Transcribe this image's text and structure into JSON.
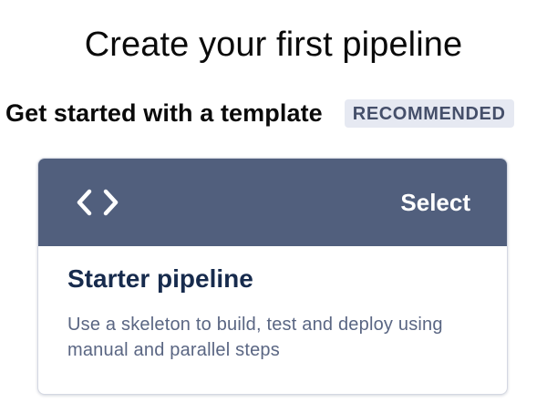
{
  "page": {
    "title": "Create your first pipeline"
  },
  "template_section": {
    "heading": "Get started with a template",
    "badge": "RECOMMENDED"
  },
  "template_card": {
    "icon": "code-icon",
    "action_label": "Select",
    "title": "Starter pipeline",
    "description": "Use a skeleton to build, test and deploy using manual and parallel steps"
  },
  "colors": {
    "card_header_bg": "#515f7d",
    "badge_bg": "#e6e9f2",
    "badge_text": "#454f6a",
    "card_title": "#172b4d",
    "card_description": "#5a6683"
  }
}
